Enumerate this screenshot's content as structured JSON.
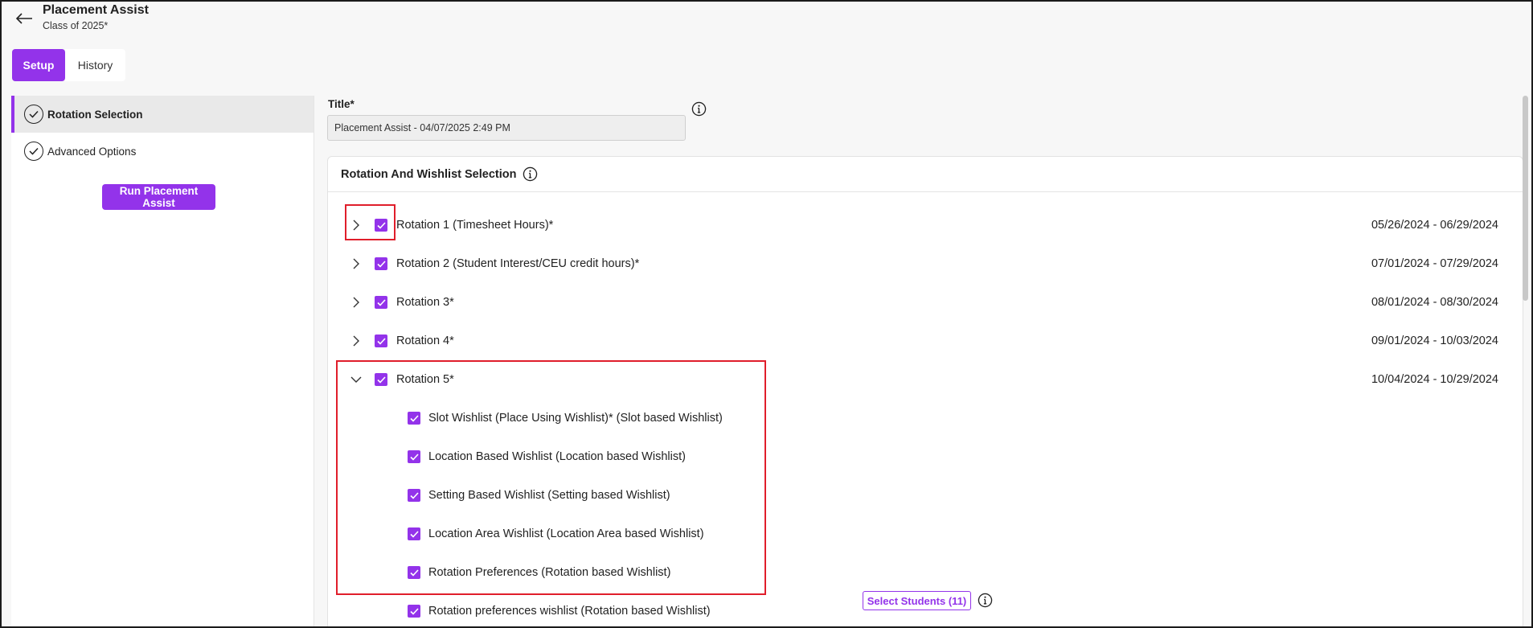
{
  "header": {
    "title": "Placement Assist",
    "subtitle": "Class of 2025*",
    "back_icon": "arrow-left-icon"
  },
  "tabs": [
    {
      "label": "Setup",
      "active": true
    },
    {
      "label": "History",
      "active": false
    }
  ],
  "sidebar": {
    "items": [
      {
        "label": "Rotation Selection",
        "active": true,
        "icon": "check-circle-icon"
      },
      {
        "label": "Advanced Options",
        "active": false,
        "icon": "check-circle-icon"
      }
    ],
    "run_button": "Run Placement Assist"
  },
  "form": {
    "title_label": "Title",
    "title_required": "*",
    "title_value": "Placement Assist - 04/07/2025 2:49 PM"
  },
  "panel": {
    "heading": "Rotation And Wishlist Selection",
    "rotations": [
      {
        "label": "Rotation 1 (Timesheet Hours)*",
        "dates": "05/26/2024 - 06/29/2024",
        "checked": true,
        "expanded": false
      },
      {
        "label": "Rotation 2 (Student Interest/CEU credit hours)*",
        "dates": "07/01/2024 - 07/29/2024",
        "checked": true,
        "expanded": false
      },
      {
        "label": "Rotation 3*",
        "dates": "08/01/2024 - 08/30/2024",
        "checked": true,
        "expanded": false
      },
      {
        "label": "Rotation 4*",
        "dates": "09/01/2024 - 10/03/2024",
        "checked": true,
        "expanded": false
      },
      {
        "label": "Rotation 5*",
        "dates": "10/04/2024 - 10/29/2024",
        "checked": true,
        "expanded": true
      }
    ],
    "wishlists": [
      {
        "label": "Slot Wishlist (Place Using Wishlist)* (Slot based Wishlist)",
        "checked": true
      },
      {
        "label": "Location Based Wishlist (Location based Wishlist)",
        "checked": true
      },
      {
        "label": "Setting Based Wishlist (Setting based Wishlist)",
        "checked": true
      },
      {
        "label": "Location Area Wishlist (Location Area based Wishlist)",
        "checked": true
      },
      {
        "label": "Rotation Preferences (Rotation based Wishlist)",
        "checked": true
      },
      {
        "label": "Rotation preferences wishlist (Rotation based Wishlist)",
        "checked": true
      }
    ],
    "select_students": "Select Students (11)"
  },
  "colors": {
    "accent": "#9333ea",
    "highlight": "#e01e2b"
  }
}
